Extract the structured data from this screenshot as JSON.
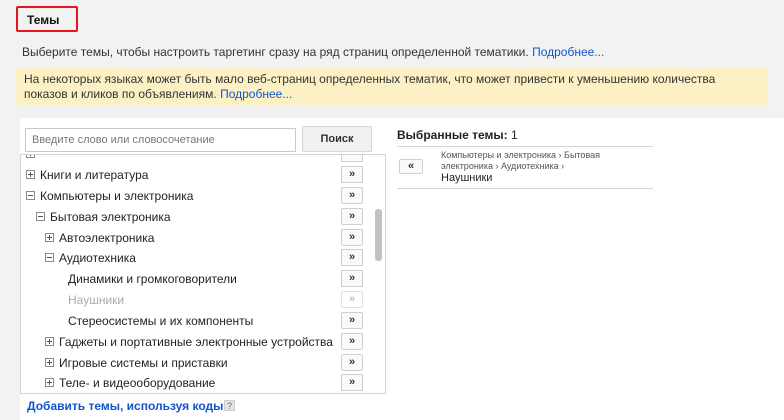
{
  "header": {
    "title": "Темы"
  },
  "intro": {
    "text": "Выберите темы, чтобы настроить таргетинг сразу на ряд страниц определенной тематики.",
    "link": "Подробнее..."
  },
  "warning": {
    "text": "На некоторых языках может быть мало веб-страниц определенных тематик, что может привести к уменьшению количества показов и кликов по объявлениям.",
    "link": "Подробнее..."
  },
  "search": {
    "placeholder": "Введите слово или словосочетание",
    "button": "Поиск"
  },
  "tree": {
    "add_symbol": "»",
    "items": [
      {
        "label": "Книги и литература",
        "toggle": "plus"
      },
      {
        "label": "Компьютеры и электроника",
        "toggle": "minus"
      },
      {
        "label": "Бытовая электроника",
        "toggle": "minus"
      },
      {
        "label": "Автоэлектроника",
        "toggle": "plus"
      },
      {
        "label": "Аудиотехника",
        "toggle": "minus"
      },
      {
        "label": "Динамики и громкоговорители",
        "toggle": "none"
      },
      {
        "label": "Наушники",
        "toggle": "none",
        "selected": true
      },
      {
        "label": "Стереосистемы и их компоненты",
        "toggle": "none"
      },
      {
        "label": "Гаджеты и портативные электронные устройства",
        "toggle": "plus"
      },
      {
        "label": "Игровые системы и приставки",
        "toggle": "plus"
      },
      {
        "label": "Теле- и видеооборудование",
        "toggle": "plus"
      }
    ]
  },
  "footer": {
    "link": "Добавить темы, используя коды",
    "help": "?"
  },
  "selected": {
    "title": "Выбранные темы:",
    "count": "1",
    "remove_symbol": "«",
    "path": "Компьютеры и электроника › Бытовая электроника › Аудиотехника ›",
    "leaf": "Наушники"
  },
  "colors": {
    "highlight_border": "#e8141b",
    "link": "#1155cc",
    "warning_bg": "#fbf1c5"
  }
}
